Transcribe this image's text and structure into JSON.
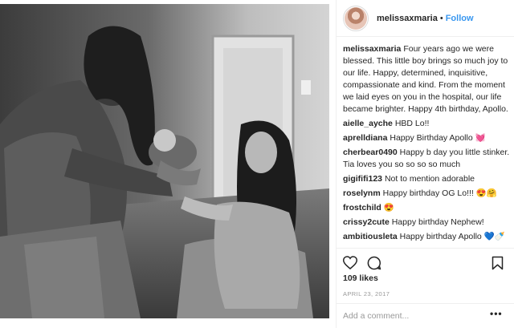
{
  "post": {
    "username": "melissaxmaria",
    "dot": "•",
    "follow_label": "Follow",
    "icons": {
      "like": "heart-icon",
      "comment": "comment-bubble-icon",
      "save": "bookmark-icon",
      "more": "ellipsis-icon"
    },
    "accent_color": "#3897f0"
  },
  "comments": [
    {
      "user": "melissaxmaria",
      "text": "Four years ago we were blessed. This little boy brings so much joy to our life. Happy, determined, inquisitive, compassionate and kind. From the moment we laid eyes on you in the hospital, our life became brighter. Happy 4th birthday, Apollo."
    },
    {
      "user": "aielle_ayche",
      "text": "HBD Lo!!"
    },
    {
      "user": "aprelldiana",
      "text": "Happy Birthday Apollo 💓"
    },
    {
      "user": "cherbear0490",
      "text": "Happy b day you little stinker. Tia loves you so so so so much"
    },
    {
      "user": "gigififi123",
      "text": "Not to mention adorable"
    },
    {
      "user": "roselynm",
      "text": "Happy birthday OG Lo!!! 😍🤗"
    },
    {
      "user": "frostchild",
      "text": "😍"
    },
    {
      "user": "crissy2cute",
      "text": "Happy birthday Nephew!"
    },
    {
      "user": "ambitiousleta",
      "text": "Happy birthday Apollo 💙🍼"
    }
  ],
  "likes": "109 likes",
  "date": "APRIL 23, 2017",
  "comment_input": {
    "placeholder": "Add a comment...",
    "more_label": "•••"
  }
}
